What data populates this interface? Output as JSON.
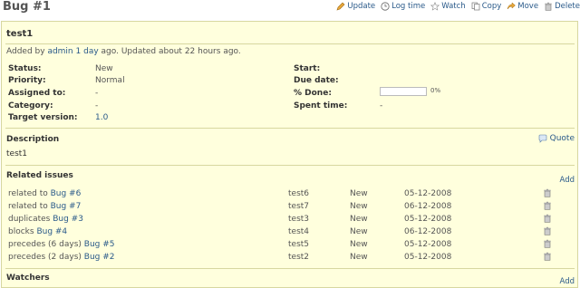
{
  "header": {
    "title": "Bug #1",
    "actions": [
      {
        "label": "Update",
        "icon": "edit-icon"
      },
      {
        "label": "Log time",
        "icon": "clock-icon"
      },
      {
        "label": "Watch",
        "icon": "star-icon"
      },
      {
        "label": "Copy",
        "icon": "copy-icon"
      },
      {
        "label": "Move",
        "icon": "move-icon"
      },
      {
        "label": "Delete",
        "icon": "trash-icon"
      }
    ]
  },
  "issue": {
    "subject": "test1",
    "author_prefix": "Added by ",
    "author": "admin",
    "created": "1 day",
    "author_mid": " ago. Updated about ",
    "updated": "22 hours",
    "author_suffix": " ago.",
    "attributes_left": [
      {
        "label": "Status:",
        "value": "New"
      },
      {
        "label": "Priority:",
        "value": "Normal"
      },
      {
        "label": "Assigned to:",
        "value": "-"
      },
      {
        "label": "Category:",
        "value": "-"
      },
      {
        "label": "Target version:",
        "value": "1.0"
      }
    ],
    "attributes_right": [
      {
        "label": "Start:",
        "value": ""
      },
      {
        "label": "Due date:",
        "value": ""
      },
      {
        "label": "% Done:",
        "value": "0%"
      },
      {
        "label": "Spent time:",
        "value": "-"
      }
    ],
    "done_ratio": 0
  },
  "description": {
    "title": "Description",
    "quote_label": "Quote",
    "text": "test1"
  },
  "related": {
    "title": "Related issues",
    "add_label": "Add",
    "rows": [
      {
        "relation": "related to ",
        "issue": "Bug #6",
        "subject": "test6",
        "status": "New",
        "date": "05-12-2008"
      },
      {
        "relation": "related to ",
        "issue": "Bug #7",
        "subject": "test7",
        "status": "New",
        "date": "06-12-2008"
      },
      {
        "relation": "duplicates ",
        "issue": "Bug #3",
        "subject": "test3",
        "status": "New",
        "date": "05-12-2008"
      },
      {
        "relation": "blocks ",
        "issue": "Bug #4",
        "subject": "test4",
        "status": "New",
        "date": "06-12-2008"
      },
      {
        "relation": "precedes (6 days) ",
        "issue": "Bug #5",
        "subject": "test5",
        "status": "New",
        "date": "05-12-2008"
      },
      {
        "relation": "precedes (2 days) ",
        "issue": "Bug #2",
        "subject": "test2",
        "status": "New",
        "date": "05-12-2008"
      }
    ]
  },
  "watchers": {
    "title": "Watchers",
    "add_label": "Add"
  },
  "colors": {
    "panel_bg": "#ffffdd",
    "panel_border": "#d7d7a0",
    "link": "#2a5a8a"
  }
}
